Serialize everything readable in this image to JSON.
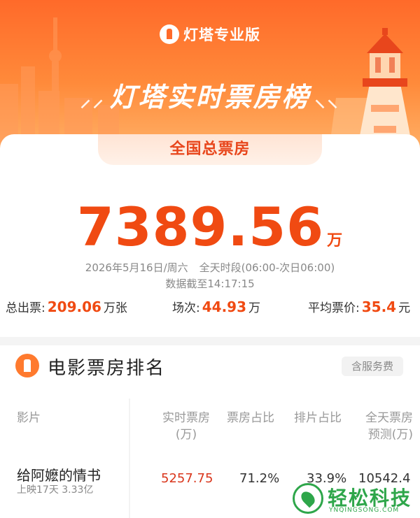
{
  "header": {
    "brand": "灯塔专业版",
    "title": "灯塔实时票房榜"
  },
  "summary": {
    "tab_label": "全国总票房",
    "total": "7389.56",
    "total_unit": "万",
    "date": "2026年5月16日/周六",
    "period": "全天时段(06:00-次日06:00)",
    "cutoff": "数据截至14:17:15",
    "tickets_label": "总出票:",
    "tickets_value": "209.06",
    "tickets_unit": "万张",
    "shows_label": "场次:",
    "shows_value": "44.93",
    "shows_unit": "万",
    "avg_price_label": "平均票价:",
    "avg_price_value": "35.4",
    "avg_price_unit": "元"
  },
  "ranking": {
    "title": "电影票房排名",
    "fee_tag": "含服务费",
    "columns": {
      "film": "影片",
      "realtime_line1": "实时票房",
      "realtime_line2": "(万)",
      "box_share": "票房占比",
      "show_share": "排片占比",
      "forecast_line1": "全天票房",
      "forecast_line2": "预测(万)"
    },
    "rows": [
      {
        "title": "给阿嬷的情书",
        "sub": "上映17天 3.33亿",
        "realtime": "5257.75",
        "box_share": "71.2%",
        "show_share": "33.9%",
        "forecast": "10542.4"
      }
    ]
  },
  "watermark": {
    "text": "轻松科技",
    "sub": "YNQINGSONG.COM"
  },
  "colors": {
    "accent": "#f04a12",
    "header_top": "#ff6a2a",
    "header_bottom": "#ffb066",
    "watermark": "#2ea64a"
  }
}
